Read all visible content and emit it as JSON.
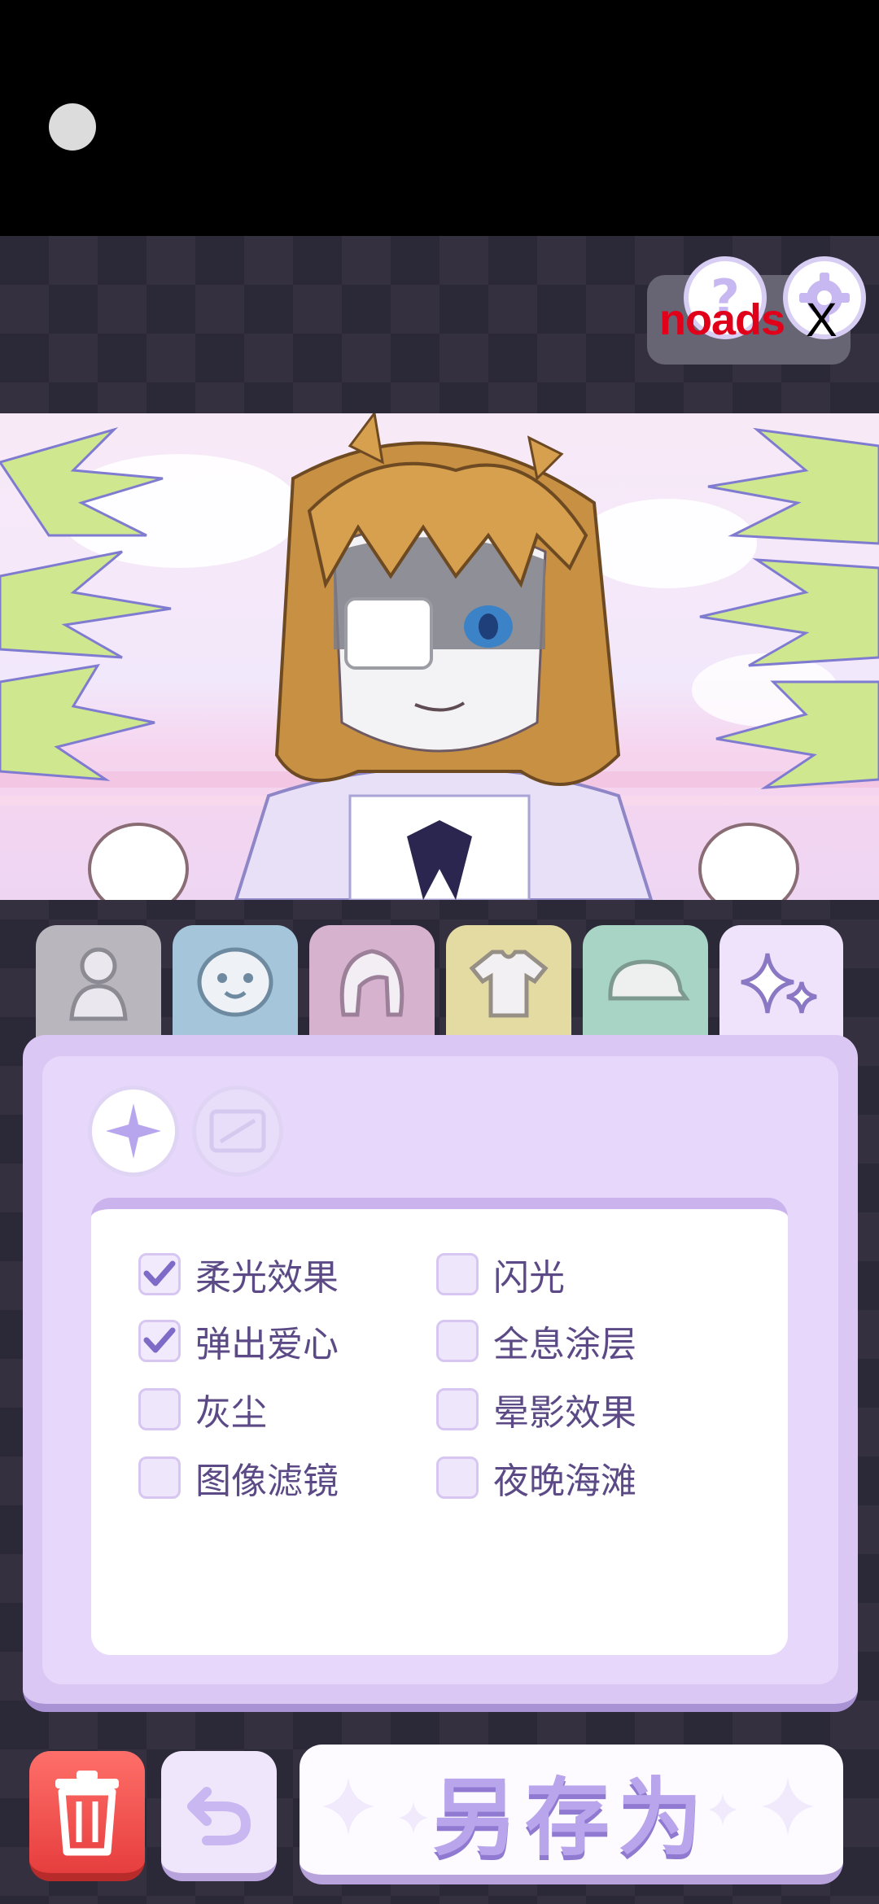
{
  "top_bar": {
    "help_label": "?",
    "noads_label": "noads",
    "close_label": "X"
  },
  "tabs": [
    {
      "name": "body",
      "icon": "person-silhouette-icon"
    },
    {
      "name": "face",
      "icon": "face-icon"
    },
    {
      "name": "hair",
      "icon": "hair-icon"
    },
    {
      "name": "clothes",
      "icon": "shirt-icon"
    },
    {
      "name": "hat",
      "icon": "cap-icon"
    },
    {
      "name": "effects",
      "icon": "sparkles-icon",
      "selected": true
    }
  ],
  "effects": {
    "options": [
      {
        "label": "柔光效果",
        "checked": true
      },
      {
        "label": "弹出爱心",
        "checked": true
      },
      {
        "label": "灰尘",
        "checked": false
      },
      {
        "label": "图像滤镜",
        "checked": false
      },
      {
        "label": "闪光",
        "checked": false
      },
      {
        "label": "全息涂层",
        "checked": false
      },
      {
        "label": "晕影效果",
        "checked": false
      },
      {
        "label": "夜晚海滩",
        "checked": false
      }
    ]
  },
  "bottom": {
    "save_as_label": "另存为"
  },
  "colors": {
    "accent": "#b9a5ec",
    "panel": "#dac7f4",
    "delete": "#e63e3e"
  }
}
